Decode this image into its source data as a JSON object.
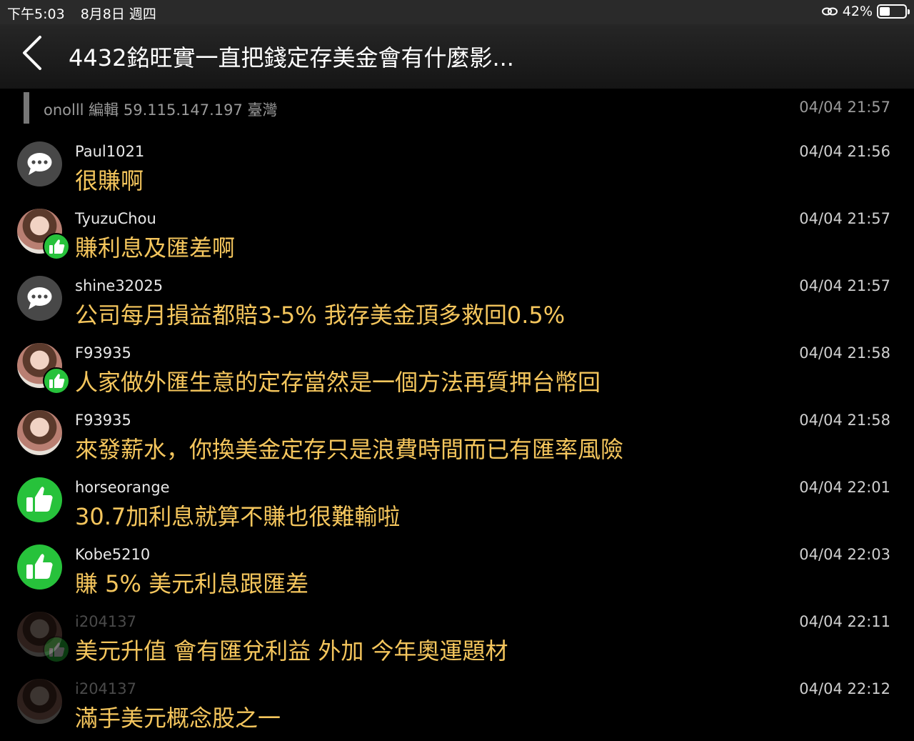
{
  "status": {
    "time": "下午5:03",
    "date": "8月8日 週四",
    "battery": "42%",
    "battery_level": 0.42
  },
  "header": {
    "title": "4432銘旺實一直把錢定存美金會有什麼影..."
  },
  "edit_info": {
    "text": "onolll 編輯  59.115.147.197 臺灣",
    "time": "04/04 21:57"
  },
  "comments": [
    {
      "user": "Paul1021",
      "time": "04/04 21:56",
      "text": "很賺啊",
      "avatar": "speech-bubble-icon"
    },
    {
      "user": "TyuzuChou",
      "time": "04/04 21:57",
      "text": "賺利息及匯差啊",
      "avatar": "photo",
      "badge": "thumbs-up-icon"
    },
    {
      "user": "shine32025",
      "time": "04/04 21:57",
      "text": "公司每月損益都賠3-5% 我存美金頂多救回0.5%",
      "avatar": "speech-bubble-icon"
    },
    {
      "user": "F93935",
      "time": "04/04 21:58",
      "text": "人家做外匯生意的定存當然是一個方法再質押台幣回",
      "avatar": "photo",
      "badge": "thumbs-up-icon"
    },
    {
      "user": "F93935",
      "time": "04/04 21:58",
      "text": "來發薪水，你換美金定存只是浪費時間而已有匯率風險",
      "avatar": "photo"
    },
    {
      "user": "horseorange",
      "time": "04/04 22:01",
      "text": "30.7加利息就算不賺也很難輸啦",
      "avatar": "thumbs-up-icon"
    },
    {
      "user": "Kobe5210",
      "time": "04/04 22:03",
      "text": "賺 5% 美元利息跟匯差",
      "avatar": "thumbs-up-icon"
    },
    {
      "user": "i204137",
      "time": "04/04 22:11",
      "text": "美元升值 會有匯兌利益 外加 今年奧運題材",
      "avatar": "photo-faint",
      "badge": "thumbs-up-icon"
    },
    {
      "user": "i204137",
      "time": "04/04 22:12",
      "text": "滿手美元概念股之一",
      "avatar": "photo-faint"
    }
  ]
}
